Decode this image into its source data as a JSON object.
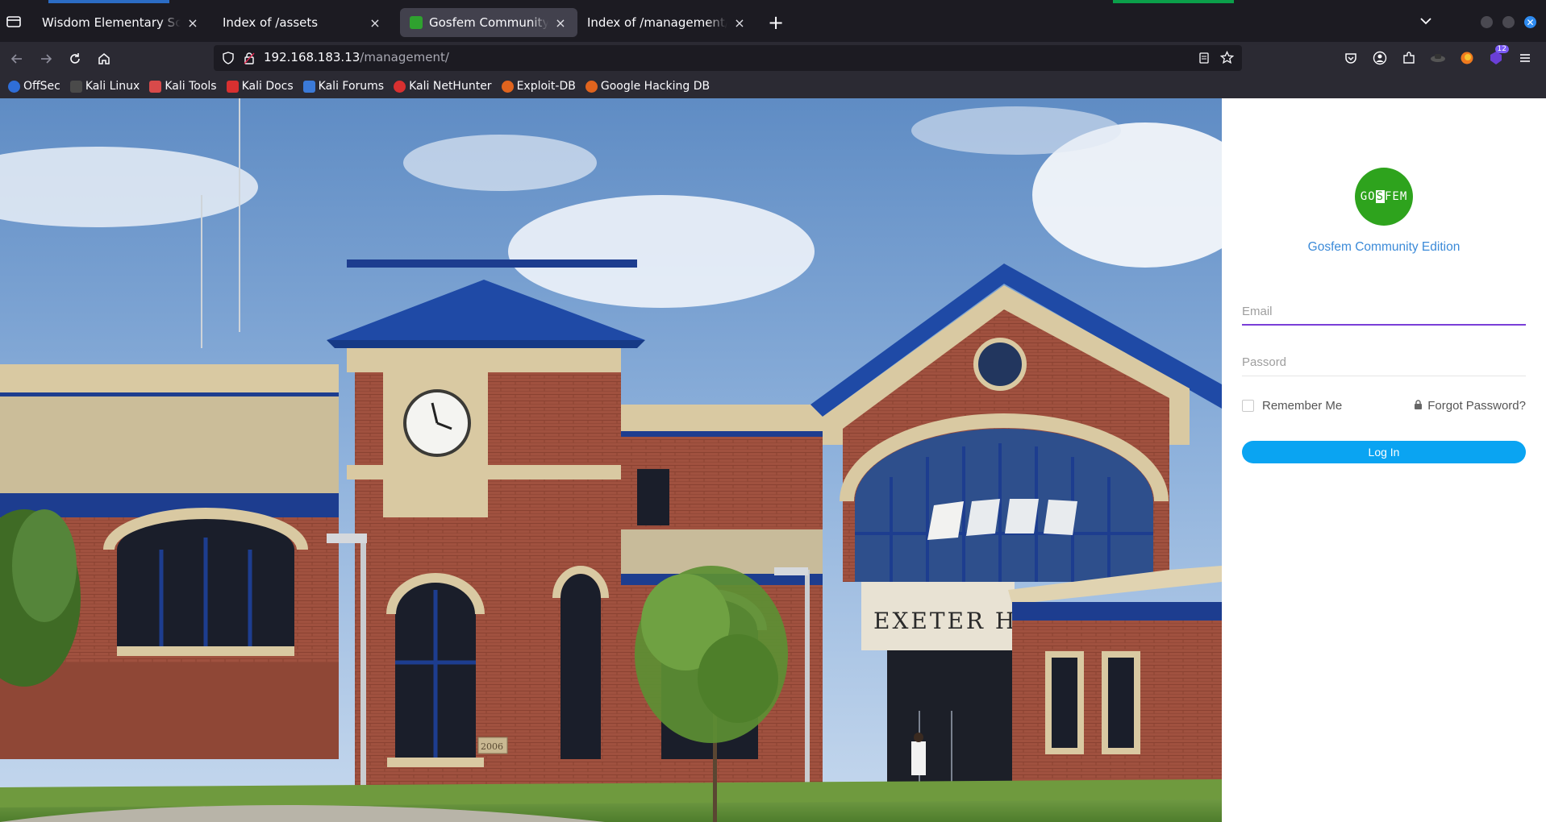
{
  "tabs": [
    {
      "title": "Wisdom Elementary School",
      "active": false
    },
    {
      "title": "Index of /assets",
      "active": false
    },
    {
      "title": "Gosfem Community Edition",
      "active": true
    },
    {
      "title": "Index of /management/uploads",
      "active": false
    }
  ],
  "tab_close_glyph": "×",
  "new_tab_glyph": "+",
  "url": {
    "host": "192.168.183.13",
    "path": "/management/"
  },
  "extension_badge": "12",
  "bookmarks": [
    {
      "label": "OffSec",
      "icon": "offsec-icon",
      "color": "#2f6ed8"
    },
    {
      "label": "Kali Linux",
      "icon": "kali-dragon-icon",
      "color": "#4a4a4a"
    },
    {
      "label": "Kali Tools",
      "icon": "kali-tools-icon",
      "color": "#d84a4a"
    },
    {
      "label": "Kali Docs",
      "icon": "kali-docs-icon",
      "color": "#d83030"
    },
    {
      "label": "Kali Forums",
      "icon": "kali-forums-icon",
      "color": "#3b7ad8"
    },
    {
      "label": "Kali NetHunter",
      "icon": "nethunter-icon",
      "color": "#d83030"
    },
    {
      "label": "Exploit-DB",
      "icon": "exploit-db-icon",
      "color": "#e0641e"
    },
    {
      "label": "Google Hacking DB",
      "icon": "ghdb-icon",
      "color": "#e0641e"
    }
  ],
  "hero": {
    "building_sign": "EXETER HIG",
    "plaque": "2006"
  },
  "login": {
    "logo_text_a": "GO",
    "logo_text_b": "S",
    "logo_text_c": "FEM",
    "brand": "Gosfem Community Edition",
    "email_placeholder": "Email",
    "password_placeholder": "Passord",
    "remember_label": "Remember Me",
    "forgot_label": "Forgot Password?",
    "login_button": "Log In"
  },
  "colors": {
    "brand_green": "#2ea31d",
    "brand_blue": "#3b8ad8",
    "button_blue": "#0aa4f2",
    "focus_purple": "#7a3ed8"
  }
}
